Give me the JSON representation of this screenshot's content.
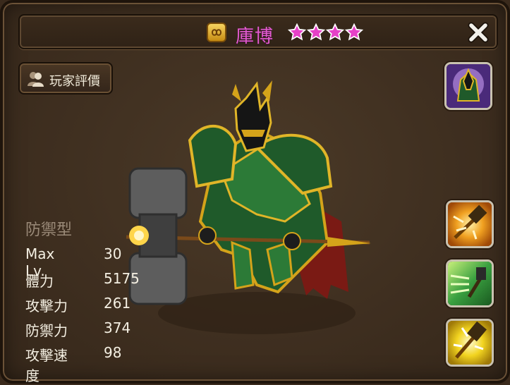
{
  "header": {
    "monster_name": "庫博",
    "stars": 4,
    "type_icon": "element-badge-icon",
    "close_icon": "close-icon"
  },
  "review_button": {
    "label": "玩家評價",
    "icon": "users-icon"
  },
  "stats": {
    "type": "防禦型",
    "rows": [
      {
        "label": "Max Lv.",
        "value": "30"
      },
      {
        "label": "體力",
        "value": "5175"
      },
      {
        "label": "攻擊力",
        "value": "261"
      },
      {
        "label": "防禦力",
        "value": "374"
      },
      {
        "label": "攻擊速度",
        "value": "98"
      }
    ]
  },
  "skills": [
    {
      "icon": "awaken-portrait-icon"
    },
    {
      "icon": "hammer-burst-icon"
    },
    {
      "icon": "hammer-dash-icon"
    },
    {
      "icon": "hammer-strike-icon"
    }
  ],
  "colors": {
    "name": "#e35bd0",
    "star": "#e640c8",
    "panel": "#3f2f20",
    "stat_text": "#f4efe2",
    "type_text": "#9a8a78"
  }
}
